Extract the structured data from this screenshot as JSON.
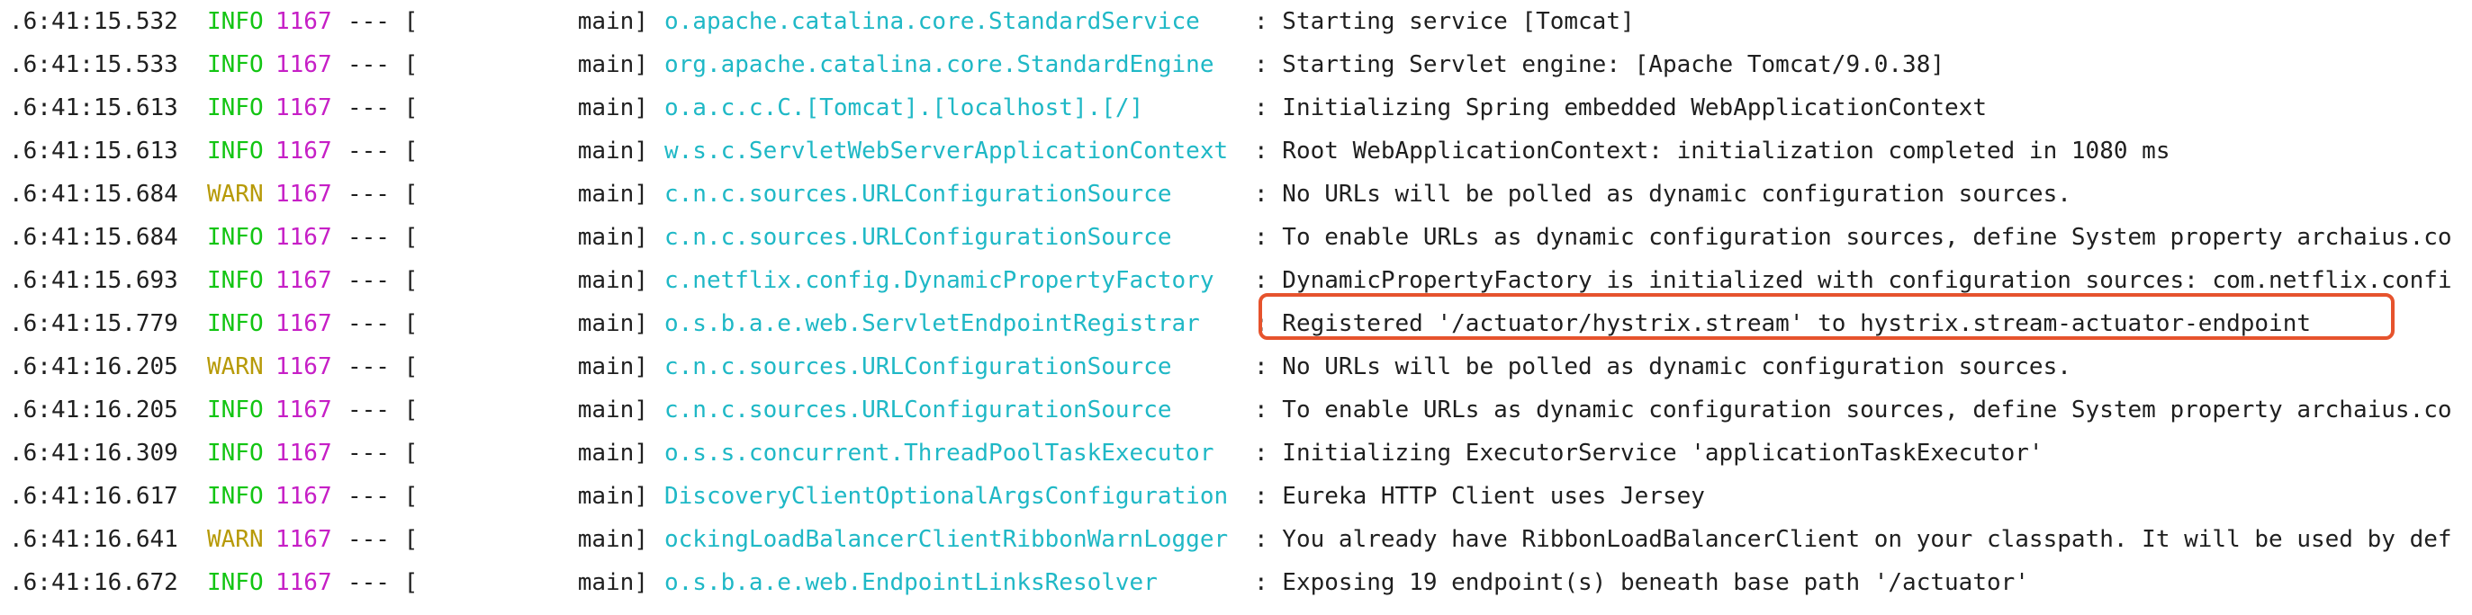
{
  "log": {
    "lines": [
      {
        "ts": ".6:41:15.532",
        "level": "INFO",
        "pid": "1167",
        "sep": "--- [",
        "thread": "main]",
        "logger": "o.apache.catalina.core.StandardService",
        "message": ": Starting service [Tomcat]"
      },
      {
        "ts": ".6:41:15.533",
        "level": "INFO",
        "pid": "1167",
        "sep": "--- [",
        "thread": "main]",
        "logger": "org.apache.catalina.core.StandardEngine",
        "message": ": Starting Servlet engine: [Apache Tomcat/9.0.38]"
      },
      {
        "ts": ".6:41:15.613",
        "level": "INFO",
        "pid": "1167",
        "sep": "--- [",
        "thread": "main]",
        "logger": "o.a.c.c.C.[Tomcat].[localhost].[/]",
        "message": ": Initializing Spring embedded WebApplicationContext"
      },
      {
        "ts": ".6:41:15.613",
        "level": "INFO",
        "pid": "1167",
        "sep": "--- [",
        "thread": "main]",
        "logger": "w.s.c.ServletWebServerApplicationContext",
        "message": ": Root WebApplicationContext: initialization completed in 1080 ms"
      },
      {
        "ts": ".6:41:15.684",
        "level": "WARN",
        "pid": "1167",
        "sep": "--- [",
        "thread": "main]",
        "logger": "c.n.c.sources.URLConfigurationSource",
        "message": ": No URLs will be polled as dynamic configuration sources."
      },
      {
        "ts": ".6:41:15.684",
        "level": "INFO",
        "pid": "1167",
        "sep": "--- [",
        "thread": "main]",
        "logger": "c.n.c.sources.URLConfigurationSource",
        "message": ": To enable URLs as dynamic configuration sources, define System property archaius.co"
      },
      {
        "ts": ".6:41:15.693",
        "level": "INFO",
        "pid": "1167",
        "sep": "--- [",
        "thread": "main]",
        "logger": "c.netflix.config.DynamicPropertyFactory",
        "message": ": DynamicPropertyFactory is initialized with configuration sources: com.netflix.confi"
      },
      {
        "ts": ".6:41:15.779",
        "level": "INFO",
        "pid": "1167",
        "sep": "--- [",
        "thread": "main]",
        "logger": "o.s.b.a.e.web.ServletEndpointRegistrar",
        "message": ": Registered '/actuator/hystrix.stream' to hystrix.stream-actuator-endpoint"
      },
      {
        "ts": ".6:41:16.205",
        "level": "WARN",
        "pid": "1167",
        "sep": "--- [",
        "thread": "main]",
        "logger": "c.n.c.sources.URLConfigurationSource",
        "message": ": No URLs will be polled as dynamic configuration sources."
      },
      {
        "ts": ".6:41:16.205",
        "level": "INFO",
        "pid": "1167",
        "sep": "--- [",
        "thread": "main]",
        "logger": "c.n.c.sources.URLConfigurationSource",
        "message": ": To enable URLs as dynamic configuration sources, define System property archaius.co"
      },
      {
        "ts": ".6:41:16.309",
        "level": "INFO",
        "pid": "1167",
        "sep": "--- [",
        "thread": "main]",
        "logger": "o.s.s.concurrent.ThreadPoolTaskExecutor",
        "message": ": Initializing ExecutorService 'applicationTaskExecutor'"
      },
      {
        "ts": ".6:41:16.617",
        "level": "INFO",
        "pid": "1167",
        "sep": "--- [",
        "thread": "main]",
        "logger": "DiscoveryClientOptionalArgsConfiguration",
        "message": ": Eureka HTTP Client uses Jersey"
      },
      {
        "ts": ".6:41:16.641",
        "level": "WARN",
        "pid": "1167",
        "sep": "--- [",
        "thread": "main]",
        "logger": "ockingLoadBalancerClientRibbonWarnLogger",
        "message": ": You already have RibbonLoadBalancerClient on your classpath. It will be used by def"
      },
      {
        "ts": ".6:41:16.672",
        "level": "INFO",
        "pid": "1167",
        "sep": "--- [",
        "thread": "main]",
        "logger": "o.s.b.a.e.web.EndpointLinksResolver",
        "message": ": Exposing 19 endpoint(s) beneath base path '/actuator'"
      }
    ],
    "highlighted_line_index": 7
  },
  "colors": {
    "info": "#13c513",
    "warn": "#b79a08",
    "pid": "#c61fc6",
    "logger": "#1fb8c6",
    "text": "#1f1f1f",
    "highlight_border": "#e6532d"
  }
}
